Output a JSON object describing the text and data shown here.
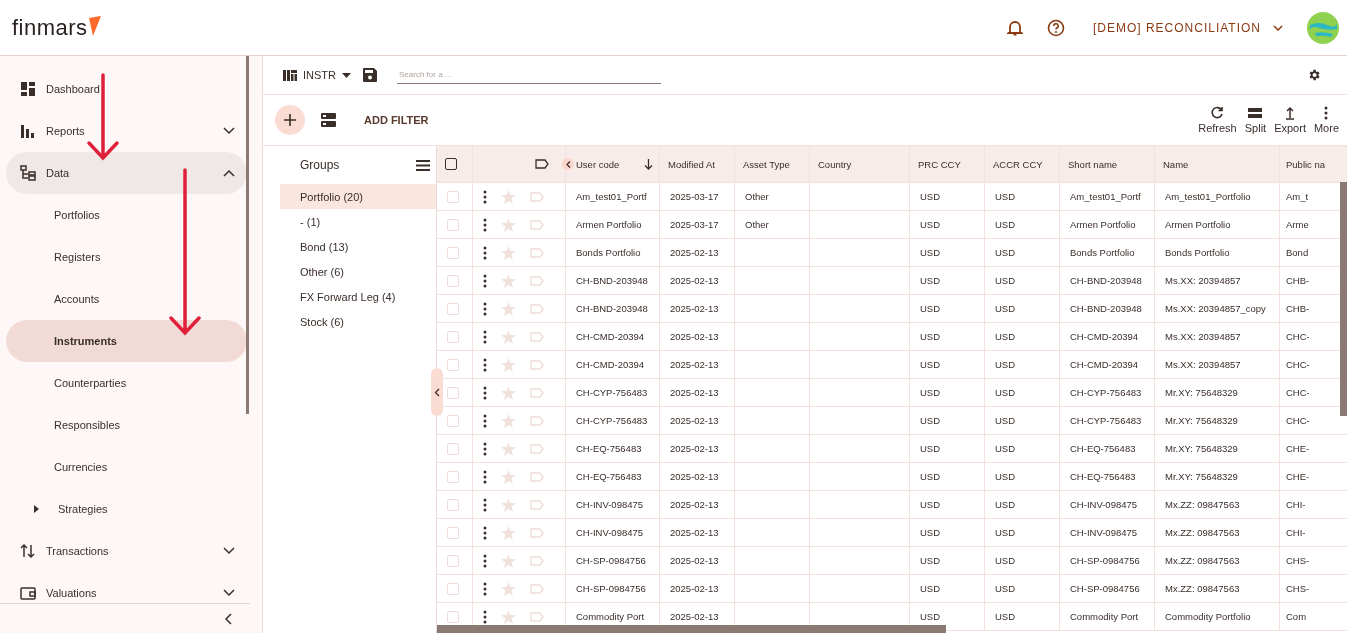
{
  "header": {
    "logo": "finmars",
    "workspace": "[DEMO] RECONCILIATION"
  },
  "sidebar": {
    "items": [
      {
        "label": "Dashboard",
        "kind": "link",
        "selected": false
      },
      {
        "label": "Reports",
        "kind": "group",
        "selected": false,
        "expanded": false
      },
      {
        "label": "Data",
        "kind": "group",
        "selected": false,
        "expanded": true,
        "children": [
          {
            "label": "Portfolios",
            "kind": "link",
            "selected": false
          },
          {
            "label": "Registers",
            "kind": "link",
            "selected": false
          },
          {
            "label": "Accounts",
            "kind": "link",
            "selected": false
          },
          {
            "label": "Instruments",
            "kind": "link",
            "selected": true
          },
          {
            "label": "Counterparties",
            "kind": "link",
            "selected": false
          },
          {
            "label": "Responsibles",
            "kind": "link",
            "selected": false
          },
          {
            "label": "Currencies",
            "kind": "link",
            "selected": false
          },
          {
            "label": "Strategies",
            "kind": "group",
            "selected": false,
            "expanded": false
          }
        ]
      },
      {
        "label": "Transactions",
        "kind": "group",
        "selected": false,
        "expanded": false
      },
      {
        "label": "Valuations",
        "kind": "group",
        "selected": false,
        "expanded": false
      }
    ]
  },
  "toolbar": {
    "layout": "INSTR",
    "search": {
      "placeholder": "Search for a ..."
    },
    "add_filter": "ADD FILTER",
    "actions": [
      "Refresh",
      "Split",
      "Export",
      "More"
    ]
  },
  "groups": {
    "title": "Groups",
    "items": [
      {
        "label": "Portfolio (20)",
        "selected": true
      },
      {
        "label": "- (1)",
        "selected": false
      },
      {
        "label": "Bond (13)",
        "selected": false
      },
      {
        "label": "Other (6)",
        "selected": false
      },
      {
        "label": "FX Forward Leg (4)",
        "selected": false
      },
      {
        "label": "Stock (6)",
        "selected": false
      }
    ]
  },
  "table": {
    "all_checked": false,
    "columns": [
      {
        "label": "User code",
        "sorted": true
      },
      {
        "label": "Modified At",
        "sorted": false
      },
      {
        "label": "Asset Type",
        "sorted": false
      },
      {
        "label": "Country",
        "sorted": false
      },
      {
        "label": "PRC CCY",
        "sorted": false
      },
      {
        "label": "ACCR CCY",
        "sorted": false
      },
      {
        "label": "Short name",
        "sorted": false
      },
      {
        "label": "Name",
        "sorted": false
      },
      {
        "label": "Public na",
        "sorted": false
      }
    ],
    "rows": [
      {
        "checked": false,
        "starred": false,
        "cells": [
          "Am_test01_Portf",
          "2025-03-17",
          "Other",
          "",
          "USD",
          "USD",
          "Am_test01_Portf",
          "Am_test01_Portfolio",
          "Am_t"
        ]
      },
      {
        "checked": false,
        "starred": false,
        "cells": [
          "Armen Portfolio",
          "2025-03-17",
          "Other",
          "",
          "USD",
          "USD",
          "Armen Portfolio",
          "Armen Portfolio",
          "Arme"
        ]
      },
      {
        "checked": false,
        "starred": false,
        "cells": [
          "Bonds Portfolio",
          "2025-02-13",
          "",
          "",
          "USD",
          "USD",
          "Bonds Portfolio",
          "Bonds Portfolio",
          "Bond"
        ]
      },
      {
        "checked": false,
        "starred": false,
        "cells": [
          "CH-BND-203948",
          "2025-02-13",
          "",
          "",
          "USD",
          "USD",
          "CH-BND-203948",
          "Ms.XX: 20394857",
          "CHB-"
        ]
      },
      {
        "checked": false,
        "starred": false,
        "cells": [
          "CH-BND-203948",
          "2025-02-13",
          "",
          "",
          "USD",
          "USD",
          "CH-BND-203948",
          "Ms.XX: 20394857_copy",
          "CHB-"
        ]
      },
      {
        "checked": false,
        "starred": false,
        "cells": [
          "CH-CMD-20394",
          "2025-02-13",
          "",
          "",
          "USD",
          "USD",
          "CH-CMD-20394",
          "Ms.XX: 20394857",
          "CHC-"
        ]
      },
      {
        "checked": false,
        "starred": false,
        "cells": [
          "CH-CMD-20394",
          "2025-02-13",
          "",
          "",
          "USD",
          "USD",
          "CH-CMD-20394",
          "Ms.XX: 20394857",
          "CHC-"
        ]
      },
      {
        "checked": false,
        "starred": false,
        "cells": [
          "CH-CYP-756483",
          "2025-02-13",
          "",
          "",
          "USD",
          "USD",
          "CH-CYP-756483",
          "Mr.XY: 75648329",
          "CHC-"
        ]
      },
      {
        "checked": false,
        "starred": false,
        "cells": [
          "CH-CYP-756483",
          "2025-02-13",
          "",
          "",
          "USD",
          "USD",
          "CH-CYP-756483",
          "Mr.XY: 75648329",
          "CHC-"
        ]
      },
      {
        "checked": false,
        "starred": false,
        "cells": [
          "CH-EQ-756483",
          "2025-02-13",
          "",
          "",
          "USD",
          "USD",
          "CH-EQ-756483",
          "Mr.XY: 75648329",
          "CHE-"
        ]
      },
      {
        "checked": false,
        "starred": false,
        "cells": [
          "CH-EQ-756483",
          "2025-02-13",
          "",
          "",
          "USD",
          "USD",
          "CH-EQ-756483",
          "Mr.XY: 75648329",
          "CHE-"
        ]
      },
      {
        "checked": false,
        "starred": false,
        "cells": [
          "CH-INV-098475",
          "2025-02-13",
          "",
          "",
          "USD",
          "USD",
          "CH-INV-098475",
          "Mx.ZZ: 09847563",
          "CHI-"
        ]
      },
      {
        "checked": false,
        "starred": false,
        "cells": [
          "CH-INV-098475",
          "2025-02-13",
          "",
          "",
          "USD",
          "USD",
          "CH-INV-098475",
          "Mx.ZZ: 09847563",
          "CHI-"
        ]
      },
      {
        "checked": false,
        "starred": false,
        "cells": [
          "CH-SP-0984756",
          "2025-02-13",
          "",
          "",
          "USD",
          "USD",
          "CH-SP-0984756",
          "Mx.ZZ: 09847563",
          "CHS-"
        ]
      },
      {
        "checked": false,
        "starred": false,
        "cells": [
          "CH-SP-0984756",
          "2025-02-13",
          "",
          "",
          "USD",
          "USD",
          "CH-SP-0984756",
          "Mx.ZZ: 09847563",
          "CHS-"
        ]
      },
      {
        "checked": false,
        "starred": false,
        "cells": [
          "Commodity Port",
          "2025-02-13",
          "",
          "",
          "USD",
          "USD",
          "Commodity Port",
          "Commodity Portfolio",
          "Com"
        ]
      }
    ]
  }
}
